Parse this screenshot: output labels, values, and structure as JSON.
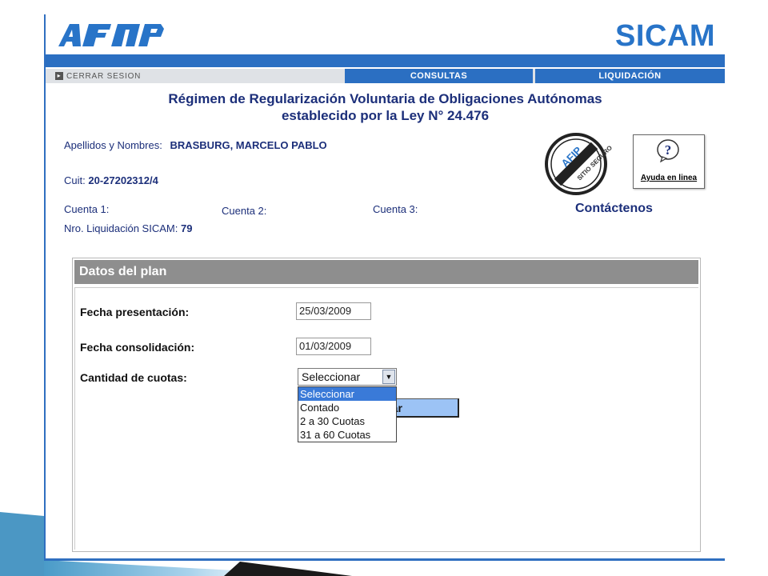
{
  "header": {
    "logo_text": "AFIP",
    "app_title": "SICAM"
  },
  "nav": {
    "logout": "CERRAR SESION",
    "tabs": [
      "CONSULTAS",
      "LIQUIDACIÓN"
    ]
  },
  "title": {
    "line1": "Régimen de Regularización Voluntaria de Obligaciones Autónomas",
    "line2": "establecido por la Ley N° 24.476"
  },
  "taxpayer": {
    "name_label": "Apellidos y Nombres:",
    "name_value": "BRASBURG, MARCELO PABLO",
    "cuit_label": "Cuit:",
    "cuit_value": "20-27202312/4",
    "cuenta1_label": "Cuenta 1:",
    "cuenta2_label": "Cuenta 2:",
    "cuenta3_label": "Cuenta 3:",
    "liquidacion_label": "Nro. Liquidación SICAM:",
    "liquidacion_value": "79"
  },
  "seal_text": "SITIO SEGURO",
  "help": {
    "label": "Ayuda en linea",
    "icon": "question-icon"
  },
  "contact": "Contáctenos",
  "panel": {
    "header": "Datos del plan",
    "fecha_presentacion_label": "Fecha presentación:",
    "fecha_presentacion_value": "25/03/2009",
    "fecha_consolidacion_label": "Fecha consolidación:",
    "fecha_consolidacion_value": "01/03/2009",
    "cuotas_label": "Cantidad de cuotas:",
    "cuotas_selected": "Seleccionar",
    "cuotas_options": [
      "Seleccionar",
      "Contado",
      "2 a 30 Cuotas",
      "31 a 60 Cuotas"
    ],
    "partial_button": "tar"
  },
  "colors": {
    "accent_blue": "#2b6fc2",
    "title_navy": "#1c2f7a",
    "panel_header_gray": "#8e8e8e",
    "selected_option": "#3a7ad8"
  }
}
